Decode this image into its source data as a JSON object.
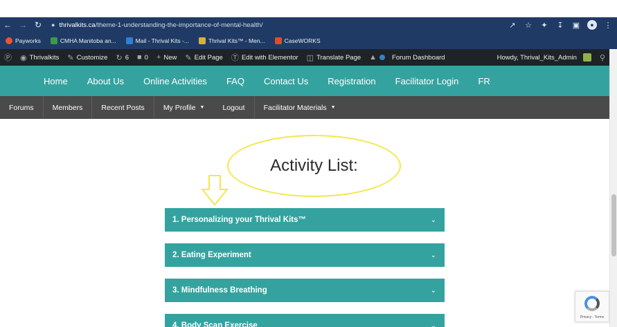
{
  "browser": {
    "url_host": "thrivalkits.ca",
    "url_path": "/theme-1-understanding-the-importance-of-mental-health/",
    "bookmarks": [
      {
        "label": "Payworks",
        "color": "#e8552f"
      },
      {
        "label": "CMHA Manitoba an...",
        "color": "#3a9a4a"
      },
      {
        "label": "Mail - Thrival Kits -...",
        "color": "#2f7fd6"
      },
      {
        "label": "Thrival Kits™ - Men...",
        "color": "#d7b23c"
      },
      {
        "label": "CaseWORKS",
        "color": "#e04a2f"
      }
    ]
  },
  "adminbar": {
    "site": "Thrivalkits",
    "customize": "Customize",
    "updates": "6",
    "comments": "0",
    "new": "New",
    "edit_page": "Edit Page",
    "edit_elementor": "Edit with Elementor",
    "translate": "Translate Page",
    "forum": "Forum Dashboard",
    "howdy": "Howdy, Thrival_Kits_Admin"
  },
  "primary_nav": [
    "Home",
    "About Us",
    "Online Activities",
    "FAQ",
    "Contact Us",
    "Registration",
    "Facilitator Login",
    "FR"
  ],
  "secondary_nav": [
    "Forums",
    "Members",
    "Recent Posts",
    "My Profile",
    "Logout",
    "Facilitator Materials"
  ],
  "content": {
    "heading": "Activity List:",
    "highlight_color": "#f2e84a",
    "accordion": [
      "1. Personalizing your Thrival Kits™",
      "2. Eating Experiment",
      "3. Mindfulness Breathing",
      "4. Body Scan Exercise"
    ]
  },
  "recaptcha": {
    "text": "Privacy - Terms"
  }
}
